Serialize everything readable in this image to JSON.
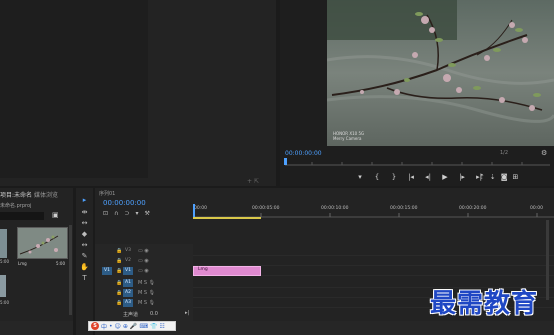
{
  "program": {
    "timecode": "00:00:00:00",
    "ratio": "1/2",
    "camera_watermark_line1": "HONOR X10 5G",
    "camera_watermark_line2": "Merry Camera",
    "transport": [
      "▾",
      "{",
      "}",
      "|◂",
      "◂|",
      "▶",
      "|▸",
      "▸|",
      "",
      "",
      "⊡",
      "⊞"
    ]
  },
  "project": {
    "tab_active": "项目:未命名",
    "tab_second": "媒体浏览",
    "file_name": "未命名.prproj",
    "thumb1_label": "5:00",
    "thumb2_name": "Lmg",
    "thumb2_duration": "5:00",
    "thumb3_label": "5:00"
  },
  "tools": [
    "▸",
    "⇹",
    "↔",
    "◆",
    "|↔|",
    "✎",
    "✋",
    "T"
  ],
  "timeline": {
    "tab": "序列01",
    "timecode": "00:00:00:00",
    "ruler_labels": [
      "00:00",
      "00:00:05:00",
      "00:00:10:00",
      "00:00:15:00",
      "00:00:20:00",
      "00:00"
    ],
    "tracks": [
      {
        "name": "V3",
        "source": "",
        "active": false,
        "kind": "video"
      },
      {
        "name": "V2",
        "source": "",
        "active": false,
        "kind": "video"
      },
      {
        "name": "V1",
        "source": "V1",
        "active": true,
        "kind": "video"
      },
      {
        "name": "A1",
        "source": "",
        "active": true,
        "kind": "audio"
      },
      {
        "name": "A2",
        "source": "",
        "active": true,
        "kind": "audio"
      },
      {
        "name": "A3",
        "source": "",
        "active": true,
        "kind": "audio"
      }
    ],
    "clip_label": "Lmg",
    "master_label": "主声道",
    "master_value": "0.0"
  },
  "ime": {
    "logo": "S",
    "items": [
      "中",
      "•",
      "☺",
      "⊕",
      "🎤",
      "⌨",
      "👕",
      "☷"
    ]
  },
  "watermark": "最需教育",
  "colors": {
    "accent": "#4ea1ff",
    "clip": "#e08ad0",
    "workarea": "#d9c84a",
    "watermark": "#1f47c4"
  }
}
